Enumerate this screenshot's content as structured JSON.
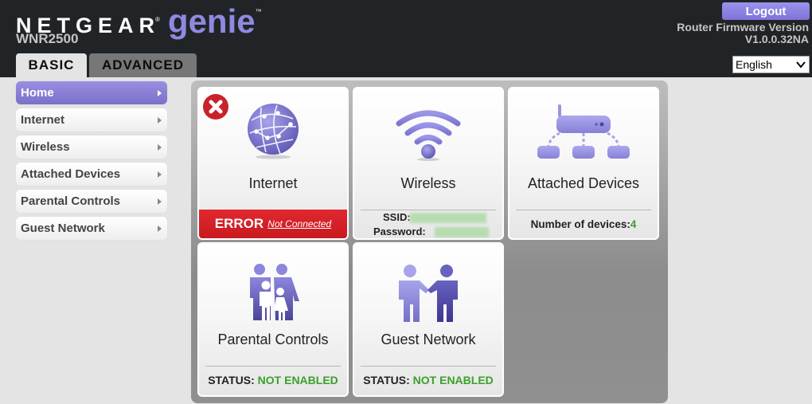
{
  "header": {
    "brand": "NETGEAR",
    "brand_reg": "®",
    "product": "genie",
    "product_tm": "™",
    "model": "WNR2500",
    "logout_label": "Logout",
    "firmware_label": "Router Firmware Version",
    "firmware_version": "V1.0.0.32NA",
    "language_selected": "English"
  },
  "tabs": [
    {
      "label": "BASIC",
      "active": true
    },
    {
      "label": "ADVANCED",
      "active": false
    }
  ],
  "sidebar": {
    "items": [
      {
        "label": "Home",
        "active": true
      },
      {
        "label": "Internet",
        "active": false
      },
      {
        "label": "Wireless",
        "active": false
      },
      {
        "label": "Attached Devices",
        "active": false
      },
      {
        "label": "Parental Controls",
        "active": false
      },
      {
        "label": "Guest Network",
        "active": false
      }
    ]
  },
  "tiles": {
    "internet": {
      "title": "Internet",
      "status_label": "ERROR",
      "status_detail": "Not Connected",
      "icon": "globe-icon",
      "badge": "error-x-icon"
    },
    "wireless": {
      "title": "Wireless",
      "ssid_label": "SSID:",
      "password_label": "Password:",
      "icon": "wifi-icon"
    },
    "attached_devices": {
      "title": "Attached Devices",
      "count_label": "Number of devices:",
      "count_value": "4",
      "icon": "router-network-icon"
    },
    "parental_controls": {
      "title": "Parental Controls",
      "status_label": "STATUS:",
      "status_value": "NOT ENABLED",
      "icon": "family-icon"
    },
    "guest_network": {
      "title": "Guest Network",
      "status_label": "STATUS:",
      "status_value": "NOT ENABLED",
      "icon": "handshake-icon"
    }
  },
  "colors": {
    "accent_purple": "#8a82dc",
    "error_red": "#d92127",
    "status_green": "#3aa12a",
    "header_bg": "#212427"
  }
}
